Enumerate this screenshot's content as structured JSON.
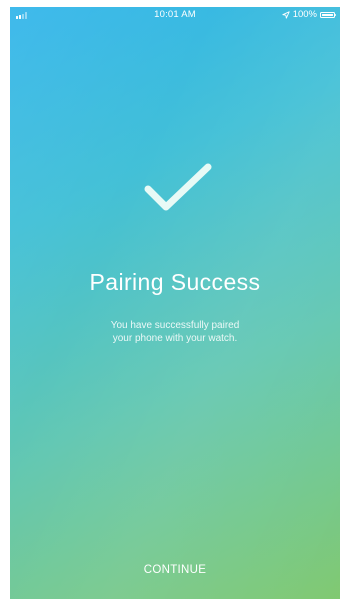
{
  "status_bar": {
    "time": "10:01 AM",
    "battery": "100%",
    "location_icon": "location-arrow-icon",
    "signal_icon": "signal-bars-icon",
    "battery_icon": "battery-icon"
  },
  "main": {
    "icon": "checkmark-icon",
    "title": "Pairing Success",
    "message_line1": "You have successfully paired",
    "message_line2": "your phone with your watch."
  },
  "footer": {
    "continue_label": "CONTINUE"
  },
  "colors": {
    "gradient_start": "#2db3ea",
    "gradient_end": "#7fc86f",
    "text": "#ffffff",
    "check": "#e8faf6"
  }
}
